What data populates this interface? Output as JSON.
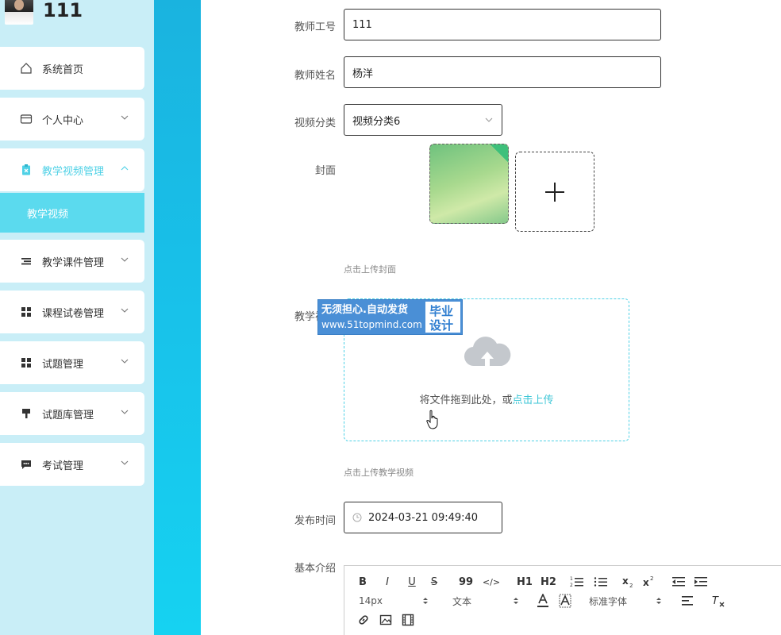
{
  "user": {
    "name": "111"
  },
  "sidebar": {
    "items": [
      {
        "label": "系统首页",
        "icon": "home-icon",
        "expandable": false
      },
      {
        "label": "个人中心",
        "icon": "wallet-icon",
        "expandable": true
      },
      {
        "label": "教学视频管理",
        "icon": "clipboard-icon",
        "expandable": true,
        "active": true
      },
      {
        "label": "教学课件管理",
        "icon": "list-icon",
        "expandable": true
      },
      {
        "label": "课程试卷管理",
        "icon": "grid-icon",
        "expandable": true
      },
      {
        "label": "试题管理",
        "icon": "grid-icon",
        "expandable": true
      },
      {
        "label": "试题库管理",
        "icon": "brush-icon",
        "expandable": true
      },
      {
        "label": "考试管理",
        "icon": "chat-icon",
        "expandable": true
      }
    ],
    "submenu": {
      "label": "教学视频"
    }
  },
  "form": {
    "teacher_id": {
      "label": "教师工号",
      "value": "111"
    },
    "teacher_name": {
      "label": "教师姓名",
      "value": "杨洋"
    },
    "category": {
      "label": "视频分类",
      "value": "视频分类6"
    },
    "cover": {
      "label": "封面",
      "hint": "点击上传封面"
    },
    "video": {
      "label": "教学视频",
      "drop_text": "将文件拖到此处，或",
      "drop_link": "点击上传",
      "hint": "点击上传教学视频"
    },
    "publish_time": {
      "label": "发布时间",
      "value": "2024-03-21 09:49:40"
    },
    "intro": {
      "label": "基本介绍"
    }
  },
  "watermark": {
    "line1": "无须担心.自动发货",
    "line2": "www.51topmind.com",
    "side1": "毕业",
    "side2": "设计"
  },
  "editor": {
    "font_size": "14px",
    "block_type": "文本",
    "font_family": "标准字体",
    "buttons": [
      "B",
      "I",
      "U",
      "S",
      "99",
      "</>",
      "H1",
      "H2"
    ]
  },
  "colors": {
    "sidebar_bg": "#c9eef7",
    "accent": "#4fd1e6",
    "submenu_bg": "#5bdaee",
    "stripe": "#18c2ea"
  }
}
